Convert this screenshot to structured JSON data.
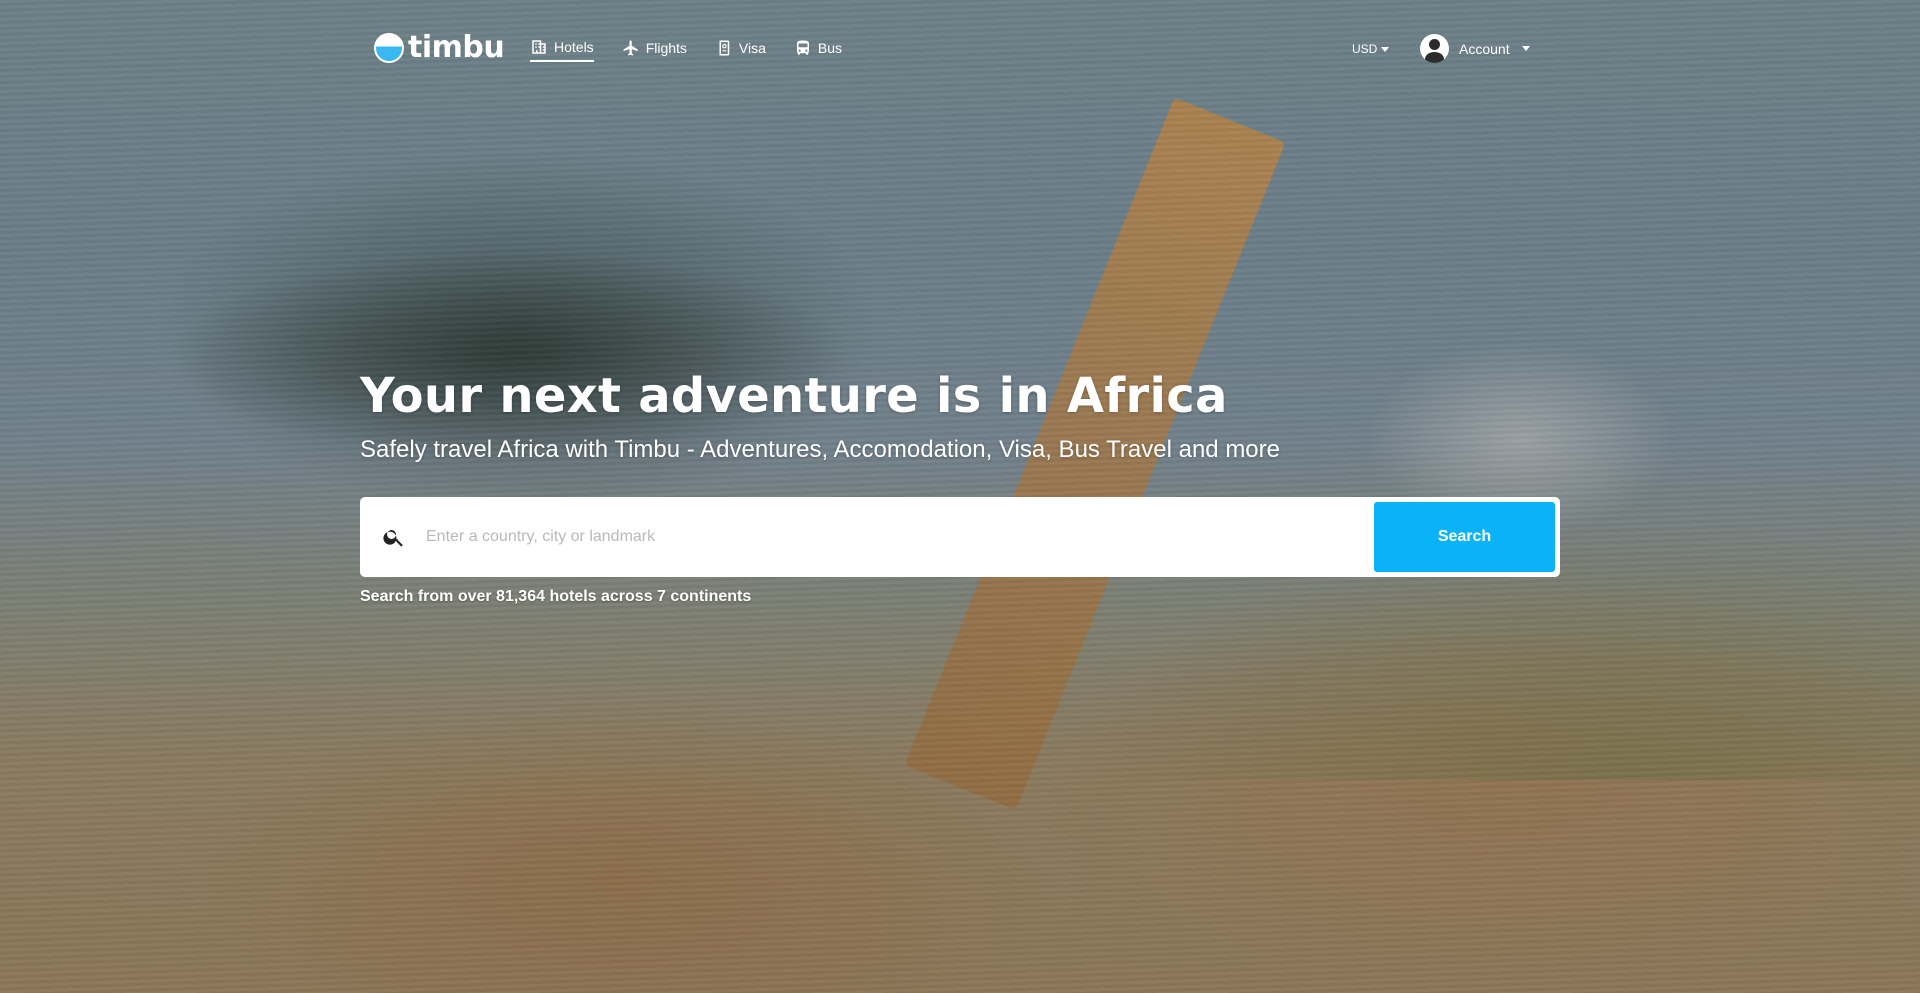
{
  "brand": {
    "name": "timbu"
  },
  "nav": {
    "items": [
      {
        "label": "Hotels",
        "icon": "building-icon",
        "active": true
      },
      {
        "label": "Flights",
        "icon": "airplane-icon",
        "active": false
      },
      {
        "label": "Visa",
        "icon": "passport-icon",
        "active": false
      },
      {
        "label": "Bus",
        "icon": "bus-icon",
        "active": false
      }
    ]
  },
  "header": {
    "currency": "USD",
    "account_label": "Account"
  },
  "hero": {
    "title": "Your next adventure is in Africa",
    "subtitle": "Safely travel Africa with Timbu - Adventures, Accomodation, Visa, Bus Travel and more",
    "search_placeholder": "Enter a country, city or landmark",
    "search_button": "Search",
    "note": "Search from over 81,364 hotels across 7 continents"
  },
  "colors": {
    "accent": "#0ab2f7",
    "text": "#ffffff"
  }
}
